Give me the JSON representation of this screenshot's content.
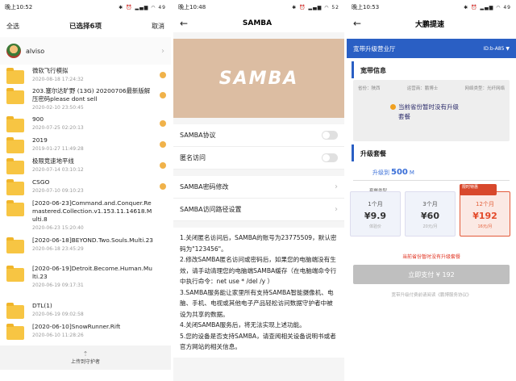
{
  "panel1": {
    "status": {
      "time": "晚上10:52",
      "icons": "✱ ⏰ ▂▄▆ ◠ 49"
    },
    "select_all": "全选",
    "title": "已选择6项",
    "cancel": "取消",
    "user": "alviso",
    "files": [
      {
        "name": "微软飞行模拟",
        "date": "2020-08-18 17:24:32",
        "checked": true
      },
      {
        "name": "203.塞尔达旷野 (13G) 20200706最新版解压密码please dont sell",
        "date": "2020-02-10 23:50:45",
        "checked": true
      },
      {
        "name": "900",
        "date": "2020-07-25 02:20:13",
        "checked": true
      },
      {
        "name": "2019",
        "date": "2019-01-27 11:49:28",
        "checked": true
      },
      {
        "name": "极限竞速地平线",
        "date": "2020-07-14 03:10:12",
        "checked": true
      },
      {
        "name": "CSGO",
        "date": "2020-07-10 09:10:23",
        "checked": true
      },
      {
        "name": "[2020-06-23]Command.and.Conquer.Remastered.Collection.v1.153.11.14618.Multi.8",
        "date": "2020-06-23 15:20:40",
        "checked": false
      },
      {
        "name": "[2020-06-18]BEYOND.Two.Souls.Multi.23",
        "date": "2020-06-18 23:45:29",
        "checked": false
      },
      {
        "name": "[2020-06-19]Detroit.Become.Human.Multi.23",
        "date": "2020-06-19 09:17:31",
        "checked": false
      },
      {
        "name": "DTL(1)",
        "date": "2020-06-19 09:02:58",
        "checked": false
      },
      {
        "name": "[2020-06-10]SnowRunner.Rift",
        "date": "2020-06-10 11:28:26",
        "checked": false
      }
    ],
    "footer": "上传到守护者"
  },
  "panel2": {
    "status": {
      "time": "晚上10:48",
      "icons": "✱ ⏰ ▂▄▆ ◠ 52"
    },
    "title": "SAMBA",
    "banner": "SAMBA",
    "rows": [
      "SAMBA协议",
      "匿名访问",
      "SAMBA密码修改",
      "SAMBA访问路径设置"
    ],
    "notes": [
      "1.关闭匿名访问后，SAMBA的账号为23775509，默认密码为\"123456\"。",
      "2.修改SAMBA匿名访问或密码后，如果您的电脑端没有生效，请手动清理您的电脑端SAMBA缓存（在电脑端命令行中执行命令：net use * /del /y ）",
      "3.SAMBA服务能让家里所有支持SAMBA智能摄像机、电脑、手机、电视或其他电子产品轻松访问数据守护者中被设为共享的数据。",
      "4.关闭SAMBA服务后，将无法实现上述功能。",
      "5.您的设备是否支持SAMBA，请查阅相关设备说明书或者官方网站的相关信息。"
    ]
  },
  "panel3": {
    "status": {
      "time": "晚上10:53",
      "icons": "✱ ⏰ ▂▄▆ ◠ 49"
    },
    "title": "大鹏提速",
    "hall": "宽带升级营业厅",
    "id": "ID:b-A85",
    "info_title": "宽带信息",
    "province_label": "省份：陕西",
    "isp_label": "运营商：鹏博士",
    "net_label": "网络类型：光纤网络",
    "notice": "当前省份暂时没有升级套餐",
    "upgrade_title": "升级套餐",
    "speed_prefix": "升级到",
    "speed_value": "500",
    "speed_unit": "M",
    "pkg_label": "套餐类型",
    "packages": [
      {
        "months": "1个月",
        "price": "9.9",
        "note": "体验价"
      },
      {
        "months": "3个月",
        "price": "60",
        "note": "20元/月"
      },
      {
        "months": "12个月",
        "price": "192",
        "note": "16元/月"
      }
    ],
    "promo_tag": "限时特惠",
    "tip": "当前省份暂时没有升级套餐",
    "pay_button": "立即支付 ¥ 192",
    "agreement": "宽带升级付费前请阅读《鹏博服务协议》"
  }
}
